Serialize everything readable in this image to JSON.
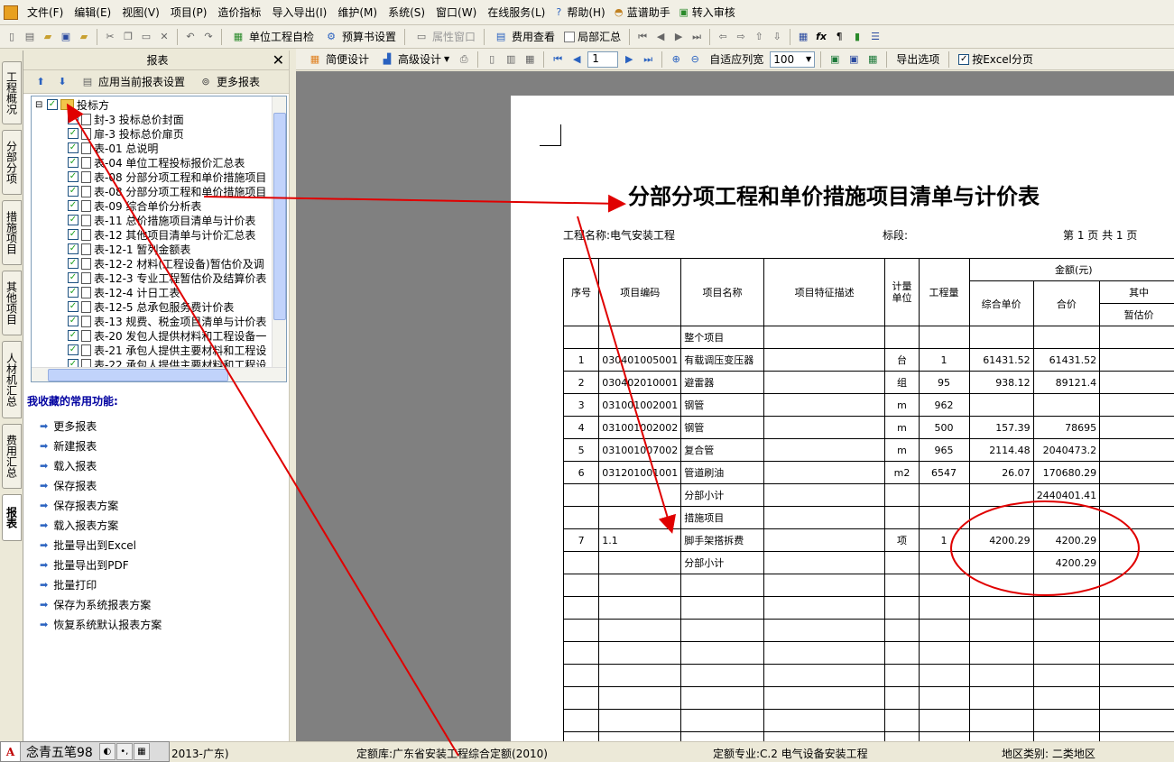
{
  "menubar": {
    "items": [
      "文件(F)",
      "编辑(E)",
      "视图(V)",
      "项目(P)",
      "造价指标",
      "导入导出(I)",
      "维护(M)",
      "系统(S)",
      "窗口(W)",
      "在线服务(L)",
      "帮助(H)",
      "蓝谱助手",
      "转入审核"
    ]
  },
  "toolbar1": {
    "self_check": "单位工程自检",
    "budget_settings": "预算书设置",
    "property_window": "属性窗口",
    "fee_view": "费用查看",
    "local_summary": "局部汇总"
  },
  "left_tabs": [
    "工程概况",
    "分部分项",
    "措施项目",
    "其他项目",
    "人材机汇总",
    "费用汇总",
    "报表"
  ],
  "report_panel": {
    "title": "报表",
    "apply_settings": "应用当前报表设置",
    "more_reports": "更多报表",
    "tree_root": "投标方",
    "tree_items": [
      "封-3 投标总价封面",
      "扉-3 投标总价扉页",
      "表-01 总说明",
      "表-04 单位工程投标报价汇总表",
      "表-08 分部分项工程和单价措施项目",
      "表-08 分部分项工程和单价措施项目",
      "表-09 综合单价分析表",
      "表-11 总价措施项目清单与计价表",
      "表-12 其他项目清单与计价汇总表",
      "表-12-1 暂列金额表",
      "表-12-2 材料(工程设备)暂估价及调",
      "表-12-3 专业工程暂估价及结算价表",
      "表-12-4 计日工表",
      "表-12-5 总承包服务费计价表",
      "表-13 规费、税金项目清单与计价表",
      "表-20 发包人提供材料和工程设备一",
      "表-21 承包人提供主要材料和工程设",
      "表-22 承包人提供主要材料和工程设"
    ],
    "fav_title": "我收藏的常用功能:",
    "fav_items": [
      "更多报表",
      "新建报表",
      "载入报表",
      "保存报表",
      "保存报表方案",
      "载入报表方案",
      "批量导出到Excel",
      "批量导出到PDF",
      "批量打印",
      "保存为系统报表方案",
      "恢复系统默认报表方案"
    ]
  },
  "toolbar2": {
    "simple_design": "简便设计",
    "advanced_design": "高级设计",
    "page_value": "1",
    "fit_width": "自适应列宽",
    "zoom_value": "100",
    "export_options": "导出选项",
    "excel_paging": "按Excel分页"
  },
  "report": {
    "title": "分部分项工程和单价措施项目清单与计价表",
    "project_label": "工程名称:电气安装工程",
    "section_label": "标段:",
    "page_info": "第 1 页 共 1 页",
    "headers": {
      "seq": "序号",
      "code": "项目编码",
      "name": "项目名称",
      "desc": "项目特征描述",
      "unit": "计量单位",
      "qty": "工程量",
      "amount": "金额(元)",
      "unit_price": "综合单价",
      "total": "合价",
      "of_which": "其中",
      "provisional": "暂估价"
    },
    "rows": [
      {
        "seq": "",
        "code": "",
        "name": "整个项目",
        "desc": "",
        "unit": "",
        "qty": "",
        "price": "",
        "total": "",
        "prov": ""
      },
      {
        "seq": "1",
        "code": "030401005001",
        "name": "有载调压变压器",
        "desc": "",
        "unit": "台",
        "qty": "1",
        "price": "61431.52",
        "total": "61431.52",
        "prov": ""
      },
      {
        "seq": "2",
        "code": "030402010001",
        "name": "避雷器",
        "desc": "",
        "unit": "组",
        "qty": "95",
        "price": "938.12",
        "total": "89121.4",
        "prov": ""
      },
      {
        "seq": "3",
        "code": "031001002001",
        "name": "钢管",
        "desc": "",
        "unit": "m",
        "qty": "962",
        "price": "",
        "total": "",
        "prov": ""
      },
      {
        "seq": "4",
        "code": "031001002002",
        "name": "钢管",
        "desc": "",
        "unit": "m",
        "qty": "500",
        "price": "157.39",
        "total": "78695",
        "prov": ""
      },
      {
        "seq": "5",
        "code": "031001007002",
        "name": "复合管",
        "desc": "",
        "unit": "m",
        "qty": "965",
        "price": "2114.48",
        "total": "2040473.2",
        "prov": ""
      },
      {
        "seq": "6",
        "code": "031201001001",
        "name": "管道刷油",
        "desc": "",
        "unit": "m2",
        "qty": "6547",
        "price": "26.07",
        "total": "170680.29",
        "prov": ""
      },
      {
        "seq": "",
        "code": "",
        "name": "分部小计",
        "desc": "",
        "unit": "",
        "qty": "",
        "price": "",
        "total": "2440401.41",
        "prov": ""
      },
      {
        "seq": "",
        "code": "",
        "name": "措施项目",
        "desc": "",
        "unit": "",
        "qty": "",
        "price": "",
        "total": "",
        "prov": ""
      },
      {
        "seq": "7",
        "code": "1.1",
        "name": "脚手架搭拆费",
        "desc": "",
        "unit": "项",
        "qty": "1",
        "price": "4200.29",
        "total": "4200.29",
        "prov": ""
      },
      {
        "seq": "",
        "code": "",
        "name": "分部小计",
        "desc": "",
        "unit": "",
        "qty": "",
        "price": "",
        "total": "4200.29",
        "prov": ""
      },
      {
        "seq": "",
        "code": "",
        "name": "",
        "desc": "",
        "unit": "",
        "qty": "",
        "price": "",
        "total": "",
        "prov": ""
      },
      {
        "seq": "",
        "code": "",
        "name": "",
        "desc": "",
        "unit": "",
        "qty": "",
        "price": "",
        "total": "",
        "prov": ""
      },
      {
        "seq": "",
        "code": "",
        "name": "",
        "desc": "",
        "unit": "",
        "qty": "",
        "price": "",
        "total": "",
        "prov": ""
      },
      {
        "seq": "",
        "code": "",
        "name": "",
        "desc": "",
        "unit": "",
        "qty": "",
        "price": "",
        "total": "",
        "prov": ""
      },
      {
        "seq": "",
        "code": "",
        "name": "",
        "desc": "",
        "unit": "",
        "qty": "",
        "price": "",
        "total": "",
        "prov": ""
      },
      {
        "seq": "",
        "code": "",
        "name": "",
        "desc": "",
        "unit": "",
        "qty": "",
        "price": "",
        "total": "",
        "prov": ""
      },
      {
        "seq": "",
        "code": "",
        "name": "",
        "desc": "",
        "unit": "",
        "qty": "",
        "price": "",
        "total": "",
        "prov": ""
      },
      {
        "seq": "",
        "code": "",
        "name": "",
        "desc": "",
        "unit": "",
        "qty": "",
        "price": "",
        "total": "",
        "prov": ""
      }
    ]
  },
  "statusbar": {
    "standard_partial": "2013-广东)",
    "quota_lib": "定额库:广东省安装工程综合定额(2010)",
    "quota_major": "定额专业:C.2 电气设备安装工程",
    "region": "地区类别: 二类地区"
  },
  "ime": {
    "name": "念青五笔98"
  },
  "annotation_color": "#e00000"
}
